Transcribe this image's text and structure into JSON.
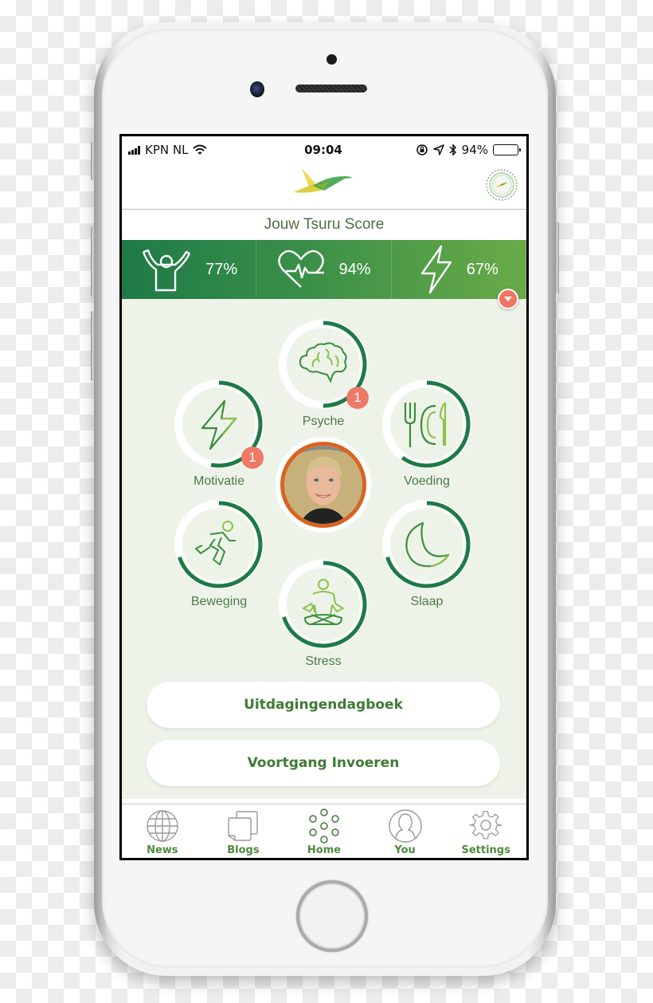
{
  "status_bar": {
    "carrier": "KPN NL",
    "time": "09:04",
    "battery_percent_label": "94%",
    "battery_level": 0.94
  },
  "header": {
    "logo_icon": "tsuru-bird-logo",
    "badge_icon": "achievement-badge-icon"
  },
  "score": {
    "title": "Jouw Tsuru Score",
    "cells": [
      {
        "icon": "cheering-person-icon",
        "value": "77%"
      },
      {
        "icon": "heartbeat-icon",
        "value": "94%"
      },
      {
        "icon": "lightning-icon",
        "value": "67%"
      }
    ],
    "dropdown_icon": "chevron-down-icon"
  },
  "categories": [
    {
      "id": "psyche",
      "label": "Psyche",
      "icon": "brain-icon",
      "progress": 0.5,
      "notifications": "1"
    },
    {
      "id": "motivatie",
      "label": "Motivatie",
      "icon": "lightning-icon",
      "progress": 0.53,
      "notifications": "1"
    },
    {
      "id": "voeding",
      "label": "Voeding",
      "icon": "fork-plate-knife-icon",
      "progress": 0.6,
      "notifications": null
    },
    {
      "id": "beweging",
      "label": "Beweging",
      "icon": "running-person-icon",
      "progress": 0.7,
      "notifications": null
    },
    {
      "id": "slaap",
      "label": "Slaap",
      "icon": "moon-icon",
      "progress": 0.7,
      "notifications": null
    },
    {
      "id": "stress",
      "label": "Stress",
      "icon": "meditation-icon",
      "progress": 0.7,
      "notifications": null
    }
  ],
  "colors": {
    "primary_green": "#1e7a47",
    "light_green": "#6aab48",
    "label_green": "#4f7a4a",
    "notification": "#ef7866",
    "avatar_ring": "#d9631f",
    "background": "#eef3ea"
  },
  "buttons": {
    "diary": "Uitdagingendagboek",
    "progress_entry": "Voortgang Invoeren"
  },
  "tab_bar": {
    "items": [
      {
        "label": "News",
        "icon": "globe-icon",
        "active": false
      },
      {
        "label": "Blogs",
        "icon": "pages-icon",
        "active": false
      },
      {
        "label": "Home",
        "icon": "dots-flower-icon",
        "active": true
      },
      {
        "label": "You",
        "icon": "user-silhouette-icon",
        "active": false
      },
      {
        "label": "Settings",
        "icon": "gear-icon",
        "active": false
      }
    ]
  }
}
